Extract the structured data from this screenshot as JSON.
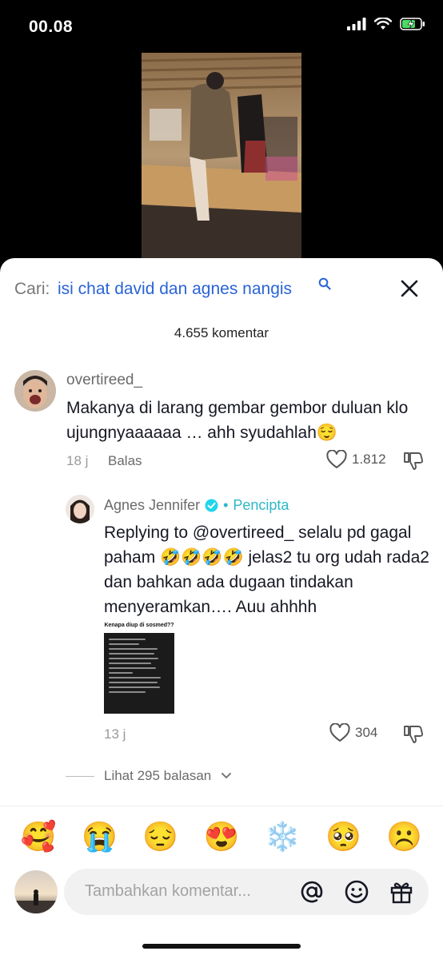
{
  "status_bar": {
    "time": "00.08"
  },
  "search": {
    "prefix": "Cari:",
    "query": "isi chat david dan agnes nangis"
  },
  "comment_count": "4.655 komentar",
  "comment": {
    "username": "overtireed_",
    "text": "Makanya di larang gembar gembor duluan klo ujungnyaaaaaa … ahh syudahlah😌",
    "time": "18 j",
    "reply_label": "Balas",
    "likes": "1.812"
  },
  "reply": {
    "username": "Agnes Jennifer",
    "creator_label": "Pencipta",
    "text": "Replying to @overtireed_ selalu pd gagal paham 🤣🤣🤣🤣 jelas2 tu org udah rada2 dan bahkan ada dugaan tindakan menyeramkan…. Auu ahhhh",
    "image_title": "Kenapa diup di sosmed??",
    "time": "13 j",
    "likes": "304"
  },
  "more_replies": "Lihat 295 balasan",
  "emoji_bar": [
    "🥰",
    "😭",
    "😔",
    "😍",
    "❄️",
    "🥺",
    "☹️"
  ],
  "comment_input": {
    "placeholder": "Tambahkan komentar..."
  },
  "colors": {
    "link_blue": "#2a64d6",
    "creator_teal": "#2fb7c7",
    "verified_blue": "#20d5ec"
  }
}
